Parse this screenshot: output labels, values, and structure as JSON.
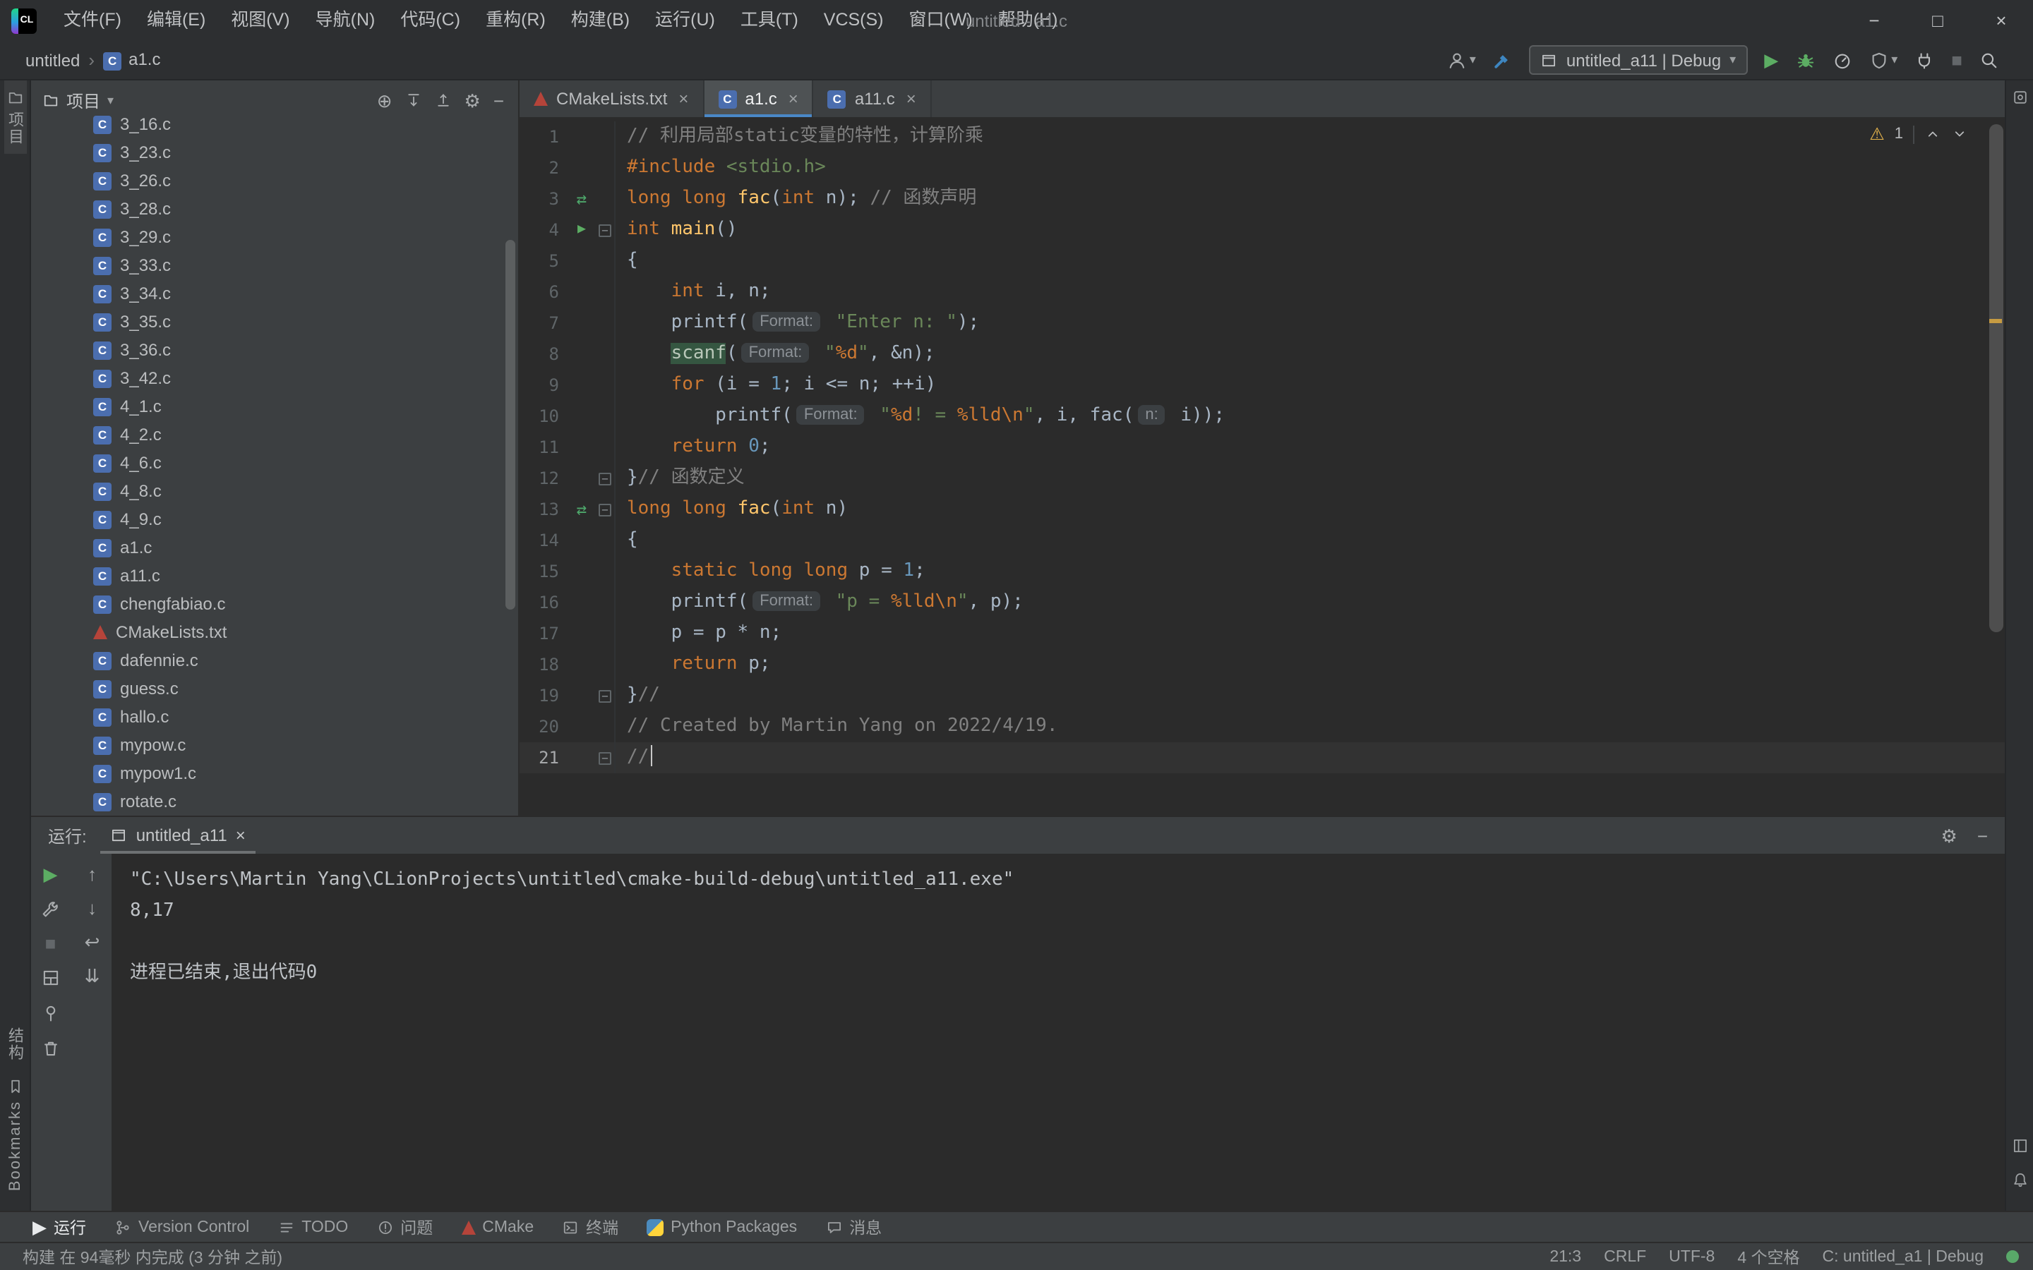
{
  "window": {
    "title": "untitled - a1.c"
  },
  "icons": {
    "logo": "CL",
    "gear": "⚙",
    "warning": "⚠",
    "play": "▶",
    "stop": "■",
    "nav_arrows": "⇄",
    "arrow_up": "↑",
    "arrow_down": "↓",
    "soft_wrap": "↩",
    "scroll_end": "⇊",
    "locate": "⊕",
    "minimize": "−",
    "maximize": "□",
    "close": "×",
    "chevron": "▾",
    "crumb_sep": "›",
    "fold": "−"
  },
  "menubar": {
    "items": [
      "文件(F)",
      "编辑(E)",
      "视图(V)",
      "导航(N)",
      "代码(C)",
      "重构(R)",
      "构建(B)",
      "运行(U)",
      "工具(T)",
      "VCS(S)",
      "窗口(W)",
      "帮助(H)"
    ]
  },
  "toolbar": {
    "breadcrumbs": [
      {
        "label": "untitled",
        "icon": null
      },
      {
        "label": "a1.c",
        "icon": "c"
      }
    ],
    "run_config": "untitled_a11 | Debug"
  },
  "left_strip": {
    "top": [
      {
        "label": "项目",
        "icon": "folder",
        "active": true
      }
    ],
    "bottom": [
      {
        "label": "结构",
        "icon": null
      },
      {
        "label": "Bookmarks",
        "icon": "bookmark"
      }
    ]
  },
  "right_strip": {
    "top": [
      "tool"
    ],
    "bottom": [
      "layout",
      "bell"
    ]
  },
  "project": {
    "title": "项目",
    "header_icons": [
      "locate",
      "expand-all",
      "collapse-all",
      "settings",
      "hide"
    ],
    "files": [
      {
        "name": "3_16.c",
        "type": "c"
      },
      {
        "name": "3_23.c",
        "type": "c"
      },
      {
        "name": "3_26.c",
        "type": "c"
      },
      {
        "name": "3_28.c",
        "type": "c"
      },
      {
        "name": "3_29.c",
        "type": "c"
      },
      {
        "name": "3_33.c",
        "type": "c"
      },
      {
        "name": "3_34.c",
        "type": "c"
      },
      {
        "name": "3_35.c",
        "type": "c"
      },
      {
        "name": "3_36.c",
        "type": "c"
      },
      {
        "name": "3_42.c",
        "type": "c"
      },
      {
        "name": "4_1.c",
        "type": "c"
      },
      {
        "name": "4_2.c",
        "type": "c"
      },
      {
        "name": "4_6.c",
        "type": "c"
      },
      {
        "name": "4_8.c",
        "type": "c"
      },
      {
        "name": "4_9.c",
        "type": "c"
      },
      {
        "name": "a1.c",
        "type": "c"
      },
      {
        "name": "a11.c",
        "type": "c"
      },
      {
        "name": "chengfabiao.c",
        "type": "c"
      },
      {
        "name": "CMakeLists.txt",
        "type": "cmake"
      },
      {
        "name": "dafennie.c",
        "type": "c"
      },
      {
        "name": "guess.c",
        "type": "c"
      },
      {
        "name": "hallo.c",
        "type": "c"
      },
      {
        "name": "mypow.c",
        "type": "c"
      },
      {
        "name": "mypow1.c",
        "type": "c"
      },
      {
        "name": "rotate.c",
        "type": "c"
      }
    ]
  },
  "editor": {
    "tabs": [
      {
        "label": "CMakeLists.txt",
        "icon": "cmake",
        "active": false
      },
      {
        "label": "a1.c",
        "icon": "c",
        "active": true
      },
      {
        "label": "a11.c",
        "icon": "c",
        "active": false
      }
    ],
    "warning_count": "1",
    "lines": [
      {
        "n": "1",
        "tokens": [
          [
            "cm",
            "// 利用局部static变量的特性，计算阶乘"
          ]
        ]
      },
      {
        "n": "2",
        "tokens": [
          [
            "kw",
            "#include"
          ],
          [
            "txt",
            " "
          ],
          [
            "str",
            "<stdio.h>"
          ]
        ]
      },
      {
        "n": "3",
        "gicon": "nav",
        "tokens": [
          [
            "kw",
            "long long"
          ],
          [
            "txt",
            " "
          ],
          [
            "fn",
            "fac"
          ],
          [
            "txt",
            "("
          ],
          [
            "kw",
            "int"
          ],
          [
            "txt",
            " n); "
          ],
          [
            "cm",
            "// 函数声明"
          ]
        ]
      },
      {
        "n": "4",
        "gicon": "run",
        "fold": true,
        "tokens": [
          [
            "kw",
            "int"
          ],
          [
            "txt",
            " "
          ],
          [
            "fn",
            "main"
          ],
          [
            "txt",
            "()"
          ]
        ]
      },
      {
        "n": "5",
        "tokens": [
          [
            "txt",
            "{"
          ]
        ]
      },
      {
        "n": "6",
        "tokens": [
          [
            "txt",
            "    "
          ],
          [
            "kw",
            "int"
          ],
          [
            "txt",
            " i, n;"
          ]
        ]
      },
      {
        "n": "7",
        "tokens": [
          [
            "txt",
            "    printf("
          ],
          [
            "inlay",
            "Format:"
          ],
          [
            "txt",
            " "
          ],
          [
            "str",
            "\"Enter n: \""
          ],
          [
            "txt",
            ");"
          ]
        ]
      },
      {
        "n": "8",
        "tokens": [
          [
            "txt",
            "    "
          ],
          [
            "hl",
            "scanf"
          ],
          [
            "txt",
            "("
          ],
          [
            "inlay",
            "Format:"
          ],
          [
            "txt",
            " "
          ],
          [
            "str",
            "\""
          ],
          [
            "esc",
            "%d"
          ],
          [
            "str",
            "\""
          ],
          [
            "txt",
            ", &n);"
          ]
        ]
      },
      {
        "n": "9",
        "tokens": [
          [
            "txt",
            "    "
          ],
          [
            "kw",
            "for"
          ],
          [
            "txt",
            " (i = "
          ],
          [
            "num",
            "1"
          ],
          [
            "txt",
            "; i <= n; ++i)"
          ]
        ]
      },
      {
        "n": "10",
        "tokens": [
          [
            "txt",
            "        printf("
          ],
          [
            "inlay",
            "Format:"
          ],
          [
            "txt",
            " "
          ],
          [
            "str",
            "\""
          ],
          [
            "esc",
            "%d"
          ],
          [
            "str",
            "! = "
          ],
          [
            "esc",
            "%lld\\n"
          ],
          [
            "str",
            "\""
          ],
          [
            "txt",
            ", i, fac("
          ],
          [
            "inlay",
            "n:"
          ],
          [
            "txt",
            " i));"
          ]
        ]
      },
      {
        "n": "11",
        "tokens": [
          [
            "txt",
            "    "
          ],
          [
            "kw",
            "return"
          ],
          [
            "txt",
            " "
          ],
          [
            "num",
            "0"
          ],
          [
            "txt",
            ";"
          ]
        ]
      },
      {
        "n": "12",
        "fold": true,
        "tokens": [
          [
            "txt",
            "}"
          ],
          [
            "cm",
            "// 函数定义"
          ]
        ]
      },
      {
        "n": "13",
        "gicon": "nav",
        "fold": true,
        "tokens": [
          [
            "kw",
            "long long"
          ],
          [
            "txt",
            " "
          ],
          [
            "fn",
            "fac"
          ],
          [
            "txt",
            "("
          ],
          [
            "kw",
            "int"
          ],
          [
            "txt",
            " n)"
          ]
        ]
      },
      {
        "n": "14",
        "tokens": [
          [
            "txt",
            "{"
          ]
        ]
      },
      {
        "n": "15",
        "tokens": [
          [
            "txt",
            "    "
          ],
          [
            "kw",
            "static"
          ],
          [
            "txt",
            " "
          ],
          [
            "kw",
            "long long"
          ],
          [
            "txt",
            " p = "
          ],
          [
            "num",
            "1"
          ],
          [
            "txt",
            ";"
          ]
        ]
      },
      {
        "n": "16",
        "tokens": [
          [
            "txt",
            "    printf("
          ],
          [
            "inlay",
            "Format:"
          ],
          [
            "txt",
            " "
          ],
          [
            "str",
            "\"p = "
          ],
          [
            "esc",
            "%lld\\n"
          ],
          [
            "str",
            "\""
          ],
          [
            "txt",
            ", p);"
          ]
        ]
      },
      {
        "n": "17",
        "tokens": [
          [
            "txt",
            "    p = p * n;"
          ]
        ]
      },
      {
        "n": "18",
        "tokens": [
          [
            "txt",
            "    "
          ],
          [
            "kw",
            "return"
          ],
          [
            "txt",
            " p;"
          ]
        ]
      },
      {
        "n": "19",
        "fold": true,
        "tokens": [
          [
            "txt",
            "}"
          ],
          [
            "cm",
            "//"
          ]
        ]
      },
      {
        "n": "20",
        "tokens": [
          [
            "cm",
            "// Created by Martin Yang on 2022/4/19."
          ]
        ]
      },
      {
        "n": "21",
        "fold": true,
        "current": true,
        "tokens": [
          [
            "cm",
            "//"
          ]
        ]
      }
    ]
  },
  "run_panel": {
    "label": "运行:",
    "tab": "untitled_a11",
    "toolbar_col1": [
      "rerun",
      "edit-configurations",
      "stop",
      "restore-layout",
      "pin",
      "clear-all"
    ],
    "toolbar_col2": [
      "prev",
      "next",
      "soft-wrap",
      "scroll-end"
    ],
    "console": [
      "\"C:\\Users\\Martin Yang\\CLionProjects\\untitled\\cmake-build-debug\\untitled_a11.exe\"",
      "8,17",
      "",
      "进程已结束,退出代码0"
    ]
  },
  "bottom_bar": {
    "items": [
      {
        "label": "运行",
        "icon": "play",
        "name": "toolwindow-run",
        "active": true
      },
      {
        "label": "Version Control",
        "icon": "branch",
        "name": "toolwindow-version-control",
        "active": false
      },
      {
        "label": "TODO",
        "icon": "todo",
        "name": "toolwindow-todo",
        "active": false
      },
      {
        "label": "问题",
        "icon": "problems",
        "name": "toolwindow-problems",
        "active": false
      },
      {
        "label": "CMake",
        "icon": "cmake",
        "name": "toolwindow-cmake",
        "active": false
      },
      {
        "label": "终端",
        "icon": "terminal",
        "name": "toolwindow-terminal",
        "active": false
      },
      {
        "label": "Python Packages",
        "icon": "python",
        "name": "toolwindow-python-packages",
        "active": false
      },
      {
        "label": "消息",
        "icon": "messages",
        "name": "toolwindow-messages",
        "active": false
      }
    ]
  },
  "status_bar": {
    "message": "构建 在 94毫秒 内完成 (3 分钟 之前)",
    "items": [
      {
        "label": "21:3",
        "name": "caret-position"
      },
      {
        "label": "CRLF",
        "name": "line-separator"
      },
      {
        "label": "UTF-8",
        "name": "file-encoding"
      },
      {
        "label": "4 个空格",
        "name": "indent-style"
      },
      {
        "label": "C: untitled_a1 | Debug",
        "name": "cmake-profile"
      }
    ]
  }
}
